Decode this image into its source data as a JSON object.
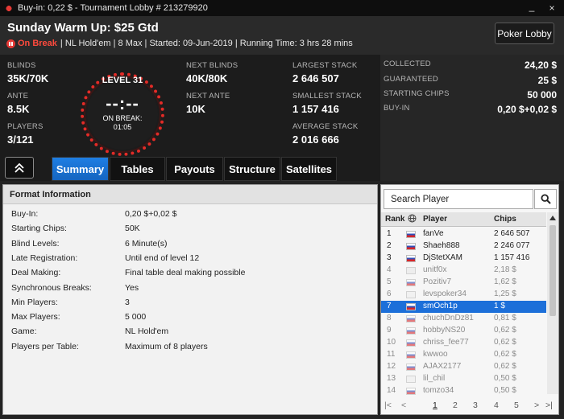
{
  "window": {
    "title": "Buy-in: 0,22 $ - Tournament Lobby # 213279920",
    "minimize": "_",
    "close": "×"
  },
  "header": {
    "title": "Sunday Warm Up: $25 Gtd",
    "status": "On Break",
    "info": "| NL Hold'em | 8 Max | Started: 09-Jun-2019 | Running Time: 3 hrs  28 mins",
    "lobby_button": "Poker Lobby"
  },
  "stats": {
    "blinds_label": "BLINDS",
    "blinds": "35K/70K",
    "ante_label": "ANTE",
    "ante": "8.5K",
    "players_label": "PLAYERS",
    "players": "3/121",
    "level": "LEVEL 31",
    "clock": "--:--",
    "on_break_label": "ON BREAK:",
    "break_time": "01:05",
    "next_blinds_label": "NEXT BLINDS",
    "next_blinds": "40K/80K",
    "next_ante_label": "NEXT ANTE",
    "next_ante": "10K",
    "largest_label": "LARGEST STACK",
    "largest": "2 646 507",
    "smallest_label": "SMALLEST STACK",
    "smallest": "1 157 416",
    "average_label": "AVERAGE STACK",
    "average": "2 016 666",
    "collected_label": "COLLECTED",
    "collected": "24,20 $",
    "guaranteed_label": "GUARANTEED",
    "guaranteed": "25 $",
    "starting_label": "STARTING CHIPS",
    "starting": "50 000",
    "buyin_label": "BUY-IN",
    "buyin": "0,20 $+0,02 $"
  },
  "tabs": [
    "Summary",
    "Tables",
    "Payouts",
    "Structure",
    "Satellites"
  ],
  "format": {
    "section": "Format Information",
    "rows": [
      {
        "k": "Buy-In:",
        "v": "0,20 $+0,02 $"
      },
      {
        "k": "Starting Chips:",
        "v": "50K"
      },
      {
        "k": "Blind Levels:",
        "v": "6 Minute(s)"
      },
      {
        "k": "Late Registration:",
        "v": "Until end of level 12"
      },
      {
        "k": "Deal Making:",
        "v": "Final table deal making possible"
      },
      {
        "k": "Synchronous Breaks:",
        "v": "Yes"
      },
      {
        "k": "Min Players:",
        "v": "3"
      },
      {
        "k": "Max Players:",
        "v": "5 000"
      },
      {
        "k": "Game:",
        "v": "NL Hold'em"
      },
      {
        "k": "Players per Table:",
        "v": "Maximum of 8 players"
      }
    ]
  },
  "players": {
    "search_placeholder": "Search Player",
    "col_rank": "Rank",
    "col_player": "Player",
    "col_chips": "Chips",
    "rows": [
      {
        "rank": "1",
        "name": "fanVe",
        "chips": "2 646 507",
        "state": "active",
        "flag": "ru"
      },
      {
        "rank": "2",
        "name": "Shaeh888",
        "chips": "2 246 077",
        "state": "active",
        "flag": "ru"
      },
      {
        "rank": "3",
        "name": "DjStetXAM",
        "chips": "1 157 416",
        "state": "active",
        "flag": "ru"
      },
      {
        "rank": "4",
        "name": "unitf0x",
        "chips": "2,18 $",
        "state": "out",
        "flag": "cr"
      },
      {
        "rank": "5",
        "name": "Pozitiv7",
        "chips": "1,62 $",
        "state": "out",
        "flag": "ru"
      },
      {
        "rank": "6",
        "name": "levspoker34",
        "chips": "1,25 $",
        "state": "out",
        "flag": "ge"
      },
      {
        "rank": "7",
        "name": "smOch1p",
        "chips": "1 $",
        "state": "selected",
        "flag": "ru"
      },
      {
        "rank": "8",
        "name": "chuchDnDz81",
        "chips": "0,81 $",
        "state": "out",
        "flag": "ru"
      },
      {
        "rank": "9",
        "name": "hobbyNS20",
        "chips": "0,62 $",
        "state": "out",
        "flag": "ru"
      },
      {
        "rank": "10",
        "name": "chriss_fee77",
        "chips": "0,62 $",
        "state": "out",
        "flag": "ru"
      },
      {
        "rank": "11",
        "name": "kwwoo",
        "chips": "0,62 $",
        "state": "out",
        "flag": "ru"
      },
      {
        "rank": "12",
        "name": "AJAX2177",
        "chips": "0,62 $",
        "state": "out",
        "flag": "ru"
      },
      {
        "rank": "13",
        "name": "lil_chil",
        "chips": "0,50 $",
        "state": "out",
        "flag": "ge"
      },
      {
        "rank": "14",
        "name": "tomzo34",
        "chips": "0,50 $",
        "state": "out",
        "flag": "ru"
      }
    ]
  },
  "pager": {
    "first": "|<",
    "prev": "<",
    "pages": [
      "1",
      "2",
      "3",
      "4",
      "5"
    ],
    "next": ">",
    "last": ">|",
    "current": "1"
  },
  "colors": {
    "accent": "#1e7ee3",
    "break_red": "#e53935",
    "selected_row": "#1c6fd9"
  }
}
